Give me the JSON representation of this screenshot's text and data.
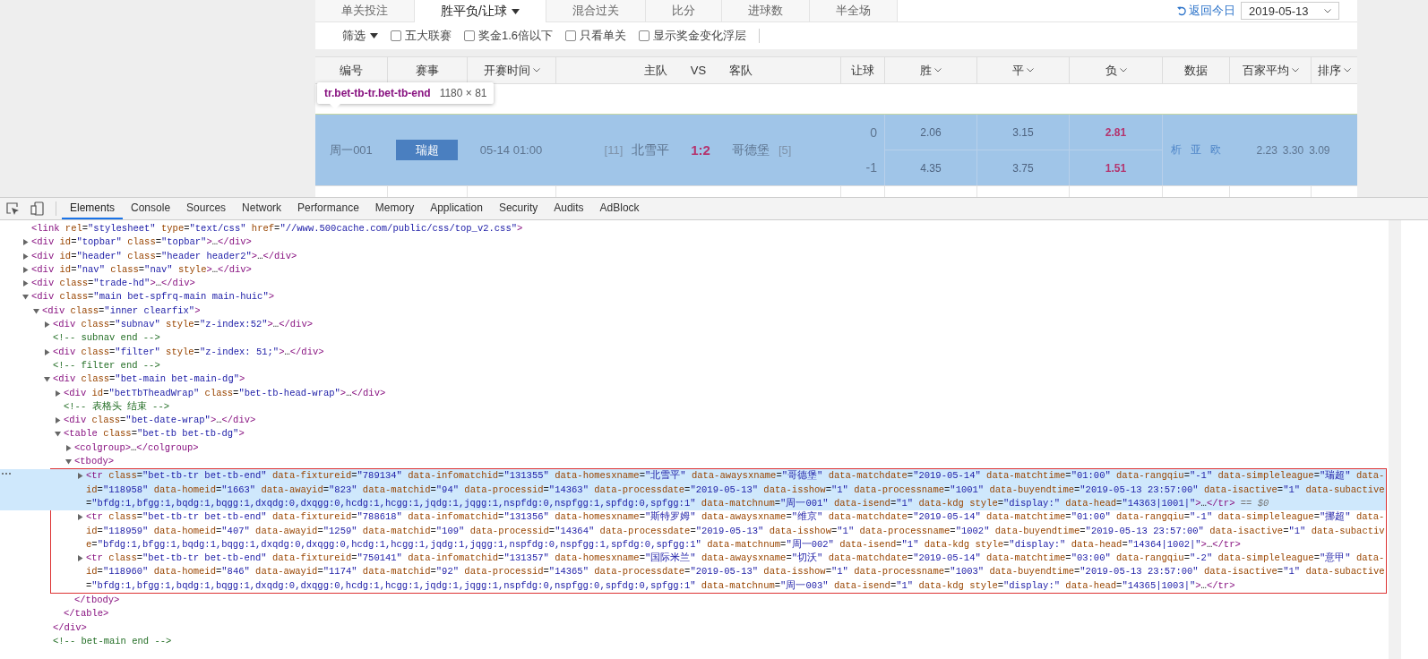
{
  "page": {
    "tabs": [
      {
        "label": "单关投注",
        "selected": false,
        "dropdown": false
      },
      {
        "label": "胜平负/让球",
        "selected": true,
        "dropdown": true
      },
      {
        "label": "混合过关",
        "selected": false,
        "dropdown": false
      },
      {
        "label": "比分",
        "selected": false,
        "dropdown": false
      },
      {
        "label": "进球数",
        "selected": false,
        "dropdown": false
      },
      {
        "label": "半全场",
        "selected": false,
        "dropdown": false
      }
    ],
    "today_link": "返回今日",
    "date_select": "2019-05-13",
    "filter": {
      "label": "筛选",
      "options": [
        {
          "label": "五大联赛",
          "checked": false
        },
        {
          "label": "奖金1.6倍以下",
          "checked": false
        },
        {
          "label": "只看单关",
          "checked": false
        },
        {
          "label": "显示奖金变化浮层",
          "checked": false
        }
      ]
    },
    "columns": [
      {
        "kind": "plain",
        "label": "编号",
        "sortable": false
      },
      {
        "kind": "plain",
        "label": "赛事",
        "sortable": false
      },
      {
        "kind": "plain",
        "label": "开赛时间",
        "sortable": true
      },
      {
        "kind": "versus",
        "home": "主队",
        "vs": "VS",
        "away": "客队"
      },
      {
        "kind": "plain",
        "label": "让球",
        "sortable": false
      },
      {
        "kind": "plain",
        "label": "胜",
        "sortable": true
      },
      {
        "kind": "plain",
        "label": "平",
        "sortable": true
      },
      {
        "kind": "plain",
        "label": "负",
        "sortable": true
      },
      {
        "kind": "plain",
        "label": "数据",
        "sortable": false
      },
      {
        "kind": "plain",
        "label": "百家平均",
        "sortable": true
      },
      {
        "kind": "plain",
        "label": "排序",
        "sortable": true
      }
    ],
    "tooltip": {
      "selector": "tr.bet-tb-tr.bet-tb-end",
      "size": "1180 × 81"
    },
    "match": {
      "number": "周一001",
      "league": "瑞超",
      "time": "05-14 01:00",
      "home_rank": "[11]",
      "home": "北雪平",
      "score": "1:2",
      "away": "哥德堡",
      "away_rank": "[5]",
      "lines": [
        {
          "handicap": "0",
          "odds": [
            {
              "value": "2.06",
              "result": false
            },
            {
              "value": "3.15",
              "result": false
            },
            {
              "value": "2.81",
              "result": true
            }
          ]
        },
        {
          "handicap": "-1",
          "odds": [
            {
              "value": "4.35",
              "result": false
            },
            {
              "value": "3.75",
              "result": false
            },
            {
              "value": "1.51",
              "result": true
            }
          ]
        }
      ],
      "data_links": [
        "析",
        "亚",
        "欧"
      ],
      "averages": [
        "2.23",
        "3.30",
        "3.09"
      ]
    }
  },
  "devtools": {
    "tabs": [
      {
        "label": "Elements",
        "selected": true
      },
      {
        "label": "Console",
        "selected": false
      },
      {
        "label": "Sources",
        "selected": false
      },
      {
        "label": "Network",
        "selected": false
      },
      {
        "label": "Performance",
        "selected": false
      },
      {
        "label": "Memory",
        "selected": false
      },
      {
        "label": "Application",
        "selected": false
      },
      {
        "label": "Security",
        "selected": false
      },
      {
        "label": "Audits",
        "selected": false
      },
      {
        "label": "AdBlock",
        "selected": false
      }
    ],
    "tree": [
      {
        "text": "<link rel=\"stylesheet\" type=\"text/css\" href=\"//www.500cache.com/public/css/top_v2.css\">"
      },
      {
        "text": "<div id=\"topbar\" class=\"topbar\">…</div>",
        "expanded": false
      },
      {
        "text": "<div id=\"header\" class=\"header header2\">…</div>",
        "expanded": false
      },
      {
        "text": "<div id=\"nav\" class=\"nav\" style>…</div>",
        "expanded": false
      },
      {
        "text": "<div class=\"trade-hd\">…</div>",
        "expanded": false
      },
      {
        "text": "<div class=\"main bet-spfrq-main main-huic\">",
        "expanded": true,
        "children": [
          {
            "text": "<div class=\"inner clearfix\">",
            "expanded": true,
            "children": [
              {
                "text": "<div class=\"subnav\" style=\"z-index:52\">…</div>",
                "expanded": false
              },
              {
                "text": "<!-- subnav end -->"
              },
              {
                "text": "<div class=\"filter\" style=\"z-index: 51;\">…</div>",
                "expanded": false
              },
              {
                "text": "<!-- filter end -->"
              },
              {
                "text": "<div class=\"bet-main bet-main-dg\">",
                "expanded": true,
                "closing": "</div>",
                "children": [
                  {
                    "text": "<div id=\"betTbTheadWrap\" class=\"bet-tb-head-wrap\">…</div>",
                    "expanded": false
                  },
                  {
                    "text": "<!-- 表格头 结束 -->"
                  },
                  {
                    "text": "<div class=\"bet-date-wrap\">…</div>",
                    "expanded": false
                  },
                  {
                    "text": "<table class=\"bet-tb bet-tb-dg\">",
                    "expanded": true,
                    "closing": "</table>",
                    "children": [
                      {
                        "text": "<colgroup>…</colgroup>",
                        "expanded": false
                      },
                      {
                        "text": "<tbody>",
                        "expanded": true,
                        "closing": "</tbody>",
                        "outlined": true,
                        "children": [
                          {
                            "text": "<tr class=\"bet-tb-tr bet-tb-end\" data-fixtureid=\"789134\" data-infomatchid=\"131355\" data-homesxname=\"北雪平\" data-awaysxname=\"哥德堡\" data-matchdate=\"2019-05-14\" data-matchtime=\"01:00\" data-rangqiu=\"-1\" data-simpleleague=\"瑞超\" data-id=\"118958\" data-homeid=\"1663\" data-awayid=\"823\" data-matchid=\"94\" data-processid=\"14363\" data-processdate=\"2019-05-13\" data-isshow=\"1\" data-processname=\"1001\" data-buyendtime=\"2019-05-13 23:57:00\" data-isactive=\"1\" data-subactive=\"bfdg:1,bfgg:1,bqdg:1,bqgg:1,dxqdg:0,dxqgg:0,hcdg:1,hcgg:1,jqdg:1,jqgg:1,nspfdg:0,nspfgg:1,spfdg:0,spfgg:1\" data-matchnum=\"周一001\" data-isend=\"1\" data-kdg style=\"display:\" data-head=\"14363|1001|\">…</tr>",
                            "expanded": false,
                            "selected": true,
                            "marker": "== $0"
                          },
                          {
                            "text": "<tr class=\"bet-tb-tr bet-tb-end\" data-fixtureid=\"788618\" data-infomatchid=\"131356\" data-homesxname=\"斯特罗姆\" data-awaysxname=\"维京\" data-matchdate=\"2019-05-14\" data-matchtime=\"01:00\" data-rangqiu=\"-1\" data-simpleleague=\"挪超\" data-id=\"118959\" data-homeid=\"407\" data-awayid=\"1259\" data-matchid=\"109\" data-processid=\"14364\" data-processdate=\"2019-05-13\" data-isshow=\"1\" data-processname=\"1002\" data-buyendtime=\"2019-05-13 23:57:00\" data-isactive=\"1\" data-subactive=\"bfdg:1,bfgg:1,bqdg:1,bqgg:1,dxqdg:0,dxqgg:0,hcdg:1,hcgg:1,jqdg:1,jqgg:1,nspfdg:0,nspfgg:1,spfdg:0,spfgg:1\" data-matchnum=\"周一002\" data-isend=\"1\" data-kdg style=\"display:\" data-head=\"14364|1002|\">…</tr>",
                            "expanded": false,
                            "selected": false
                          },
                          {
                            "text": "<tr class=\"bet-tb-tr bet-tb-end\" data-fixtureid=\"750141\" data-infomatchid=\"131357\" data-homesxname=\"国际米兰\" data-awaysxname=\"切沃\" data-matchdate=\"2019-05-14\" data-matchtime=\"03:00\" data-rangqiu=\"-2\" data-simpleleague=\"意甲\" data-id=\"118960\" data-homeid=\"846\" data-awayid=\"1174\" data-matchid=\"92\" data-processid=\"14365\" data-processdate=\"2019-05-13\" data-isshow=\"1\" data-processname=\"1003\" data-buyendtime=\"2019-05-13 23:57:00\" data-isactive=\"1\" data-subactive=\"bfdg:1,bfgg:1,bqdg:1,bqgg:1,dxqdg:0,dxqgg:0,hcdg:1,hcgg:1,jqdg:1,jqgg:1,nspfdg:0,nspfgg:0,spfdg:0,spfgg:1\" data-matchnum=\"周一003\" data-isend=\"1\" data-kdg style=\"display:\" data-head=\"14365|1003|\">…</tr>",
                            "expanded": false,
                            "selected": false
                          }
                        ]
                      }
                    ]
                  }
                ]
              },
              {
                "text": "<!-- bet-main end -->"
              }
            ]
          }
        ]
      }
    ]
  }
}
